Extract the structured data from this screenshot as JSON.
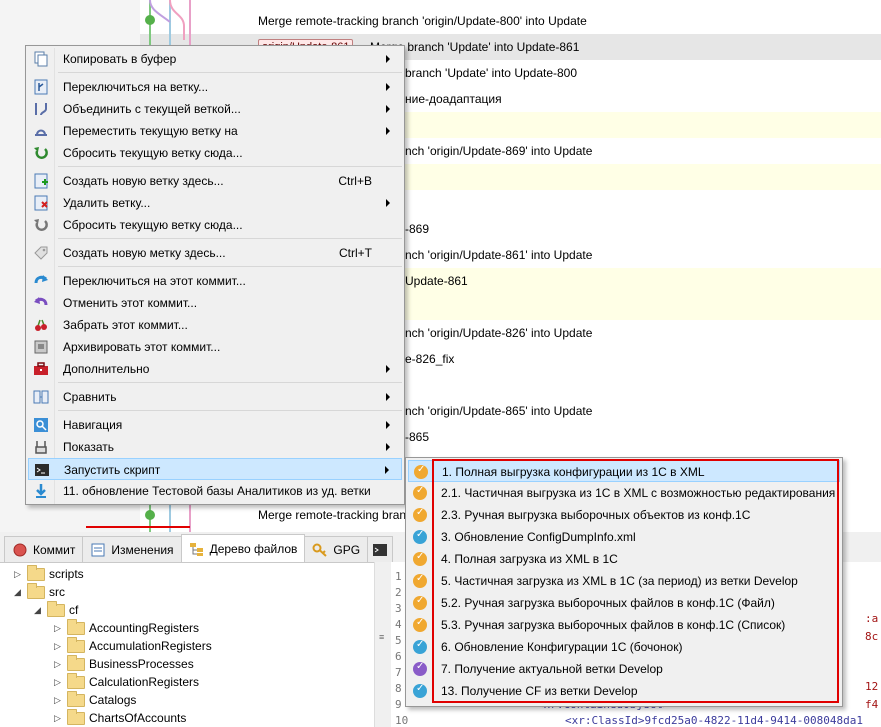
{
  "colors": {
    "accent_hover": "#cde8ff",
    "highlight_outline": "#e00000",
    "script_orange": "#f0a830",
    "script_blue": "#39a3d6",
    "script_purple": "#8a5cc8"
  },
  "revisions": [
    {
      "message": "Merge remote-tracking branch 'origin/Update-800' into Update",
      "state": "normal"
    },
    {
      "tag": "origin/Update-861",
      "message": "Merge branch 'Update' into Update-861",
      "state": "selected"
    },
    {
      "message": "branch 'Update' into Update-800",
      "state": "normal"
    },
    {
      "message": "ние-доадаптация",
      "state": "normal"
    },
    {
      "message": "",
      "state": "highlight"
    },
    {
      "message": "nch 'origin/Update-869' into Update",
      "state": "normal"
    },
    {
      "message": "",
      "state": "highlight"
    },
    {
      "message": "",
      "state": "normal"
    },
    {
      "message": "-869",
      "state": "normal"
    },
    {
      "message": "nch 'origin/Update-861' into Update",
      "state": "normal"
    },
    {
      "message": "Update-861",
      "state": "highlight"
    },
    {
      "message": "",
      "state": "highlight"
    },
    {
      "message": "nch 'origin/Update-826' into Update",
      "state": "normal"
    },
    {
      "message": "e-826_fix",
      "state": "normal"
    },
    {
      "message": "",
      "state": "normal"
    },
    {
      "message": "nch 'origin/Update-865' into Update",
      "state": "normal"
    },
    {
      "message": "-865",
      "state": "normal"
    },
    {
      "message": "",
      "state": "normal"
    },
    {
      "message": "",
      "state": "normal"
    },
    {
      "message": "Merge remote-tracking branch",
      "state": "normal"
    }
  ],
  "context_menu": {
    "items": [
      {
        "label": "Копировать в буфер",
        "icon": "copy-icon",
        "submenu": true
      },
      {
        "separator": true
      },
      {
        "label": "Переключиться на ветку...",
        "icon": "checkout-branch-icon",
        "submenu": true
      },
      {
        "label": "Объединить с текущей веткой...",
        "icon": "merge-icon",
        "submenu": true
      },
      {
        "label": "Переместить текущую ветку на",
        "icon": "rebase-icon",
        "submenu": true
      },
      {
        "label": "Сбросить текущую ветку сюда...",
        "icon": "reset-icon"
      },
      {
        "separator": true
      },
      {
        "label": "Создать новую ветку здесь...",
        "icon": "new-branch-icon",
        "shortcut": "Ctrl+B"
      },
      {
        "label": "Удалить ветку...",
        "icon": "delete-branch-icon",
        "submenu": true
      },
      {
        "label": "Сбросить текущую ветку сюда...",
        "icon": "reset-gray-icon"
      },
      {
        "separator": true
      },
      {
        "label": "Создать новую метку здесь...",
        "icon": "tag-icon",
        "shortcut": "Ctrl+T"
      },
      {
        "separator": true
      },
      {
        "label": "Переключиться на этот коммит...",
        "icon": "checkout-commit-icon"
      },
      {
        "label": "Отменить этот коммит...",
        "icon": "revert-icon"
      },
      {
        "label": "Забрать этот коммит...",
        "icon": "cherry-pick-icon"
      },
      {
        "label": "Архивировать этот коммит...",
        "icon": "archive-icon"
      },
      {
        "label": "Дополнительно",
        "icon": "toolbox-icon",
        "submenu": true
      },
      {
        "separator": true
      },
      {
        "label": "Сравнить",
        "icon": "compare-icon",
        "submenu": true
      },
      {
        "separator": true
      },
      {
        "label": "Навигация",
        "icon": "navigate-icon",
        "submenu": true
      },
      {
        "label": "Показать",
        "icon": "show-icon",
        "submenu": true
      },
      {
        "label": "Запустить скрипт",
        "icon": "console-icon",
        "submenu": true,
        "active": true
      },
      {
        "label": "11. обновление Тестовой базы Аналитиков из уд. ветки",
        "icon": "download-arrow-icon"
      }
    ]
  },
  "script_submenu": [
    {
      "label": "1. Полная выгрузка конфигурации из 1С в XML",
      "color": "orange",
      "active": true
    },
    {
      "label": "2.1. Частичная выгрузка из 1С в XML с возможностью редактирования",
      "color": "orange"
    },
    {
      "label": "2.3. Ручная выгрузка выборочных объектов из конф.1С",
      "color": "orange"
    },
    {
      "label": "3. Обновление ConfigDumpInfo.xml",
      "color": "blue"
    },
    {
      "label": "4. Полная загрузка из XML в 1С",
      "color": "orange"
    },
    {
      "label": "5. Частичная загрузка из XML в 1С (за период) из ветки Develop",
      "color": "orange"
    },
    {
      "label": "5.2. Ручная загрузка выборочных файлов в конф.1С (Файл)",
      "color": "orange"
    },
    {
      "label": "5.3. Ручная загрузка выборочных файлов в конф.1С (Список)",
      "color": "orange"
    },
    {
      "label": "6. Обновление Конфигурации 1С (бочонок)",
      "color": "blue"
    },
    {
      "label": "7. Получение актуальной ветки Develop",
      "color": "purple"
    },
    {
      "label": "13. Получение CF из ветки Develop",
      "color": "blue"
    }
  ],
  "bottom_tabs": [
    {
      "label": "Коммит",
      "icon": "commit-icon"
    },
    {
      "label": "Изменения",
      "icon": "diff-icon"
    },
    {
      "label": "Дерево файлов",
      "icon": "file-tree-icon",
      "active": true
    },
    {
      "label": "GPG",
      "icon": "key-icon"
    },
    {
      "label": "",
      "icon": "console-icon"
    }
  ],
  "file_tree": [
    {
      "label": "scripts",
      "depth": 0
    },
    {
      "label": "src",
      "depth": 0,
      "expanded": true
    },
    {
      "label": "cf",
      "depth": 1,
      "expanded": true
    },
    {
      "label": "AccountingRegisters",
      "depth": 2
    },
    {
      "label": "AccumulationRegisters",
      "depth": 2
    },
    {
      "label": "BusinessProcesses",
      "depth": 2
    },
    {
      "label": "CalculationRegisters",
      "depth": 2
    },
    {
      "label": "Catalogs",
      "depth": 2
    },
    {
      "label": "ChartsOfAccounts",
      "depth": 2
    }
  ],
  "code_view": {
    "line_numbers": [
      "1",
      "2",
      "3",
      "4",
      "5",
      "6",
      "7",
      "8",
      "9",
      "10"
    ],
    "fragments": [
      ":a",
      "8c",
      "12",
      "f4"
    ],
    "line9": "<xr:ContainedObject>",
    "line10": "<xr:ClassId>9fcd25a0-4822-11d4-9414-008048da1"
  }
}
